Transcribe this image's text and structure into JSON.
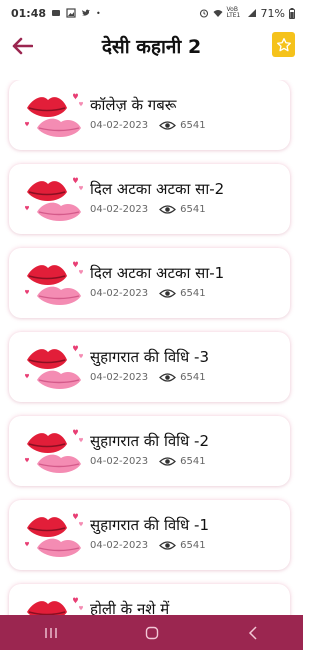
{
  "status_bar": {
    "time": "01:48",
    "network_label": "VoB LTE1",
    "battery": "71%",
    "left_icons": [
      "notification-message-icon",
      "gallery-icon",
      "twitter-icon",
      "telegram-icon"
    ],
    "right_icons": [
      "alarm-icon",
      "wifi-icon",
      "signal-icon",
      "battery-icon"
    ]
  },
  "app_bar": {
    "title": "देसी कहानी 2",
    "back_icon": "arrow-left-icon",
    "favorite_icon": "star-icon",
    "accent": "#9b2650",
    "favorite_color": "#f5c21b"
  },
  "stories": [
    {
      "title": "कॉलेज़ के गबरू",
      "date": "04-02-2023",
      "views": "6541",
      "thumb_icon": "lips-hearts-icon"
    },
    {
      "title": "दिल अटका अटका सा-2",
      "date": "04-02-2023",
      "views": "6541",
      "thumb_icon": "lips-hearts-icon"
    },
    {
      "title": "दिल अटका अटका सा-1",
      "date": "04-02-2023",
      "views": "6541",
      "thumb_icon": "lips-hearts-icon"
    },
    {
      "title": "सुहागरात की विधि -3",
      "date": "04-02-2023",
      "views": "6541",
      "thumb_icon": "lips-hearts-icon"
    },
    {
      "title": "सुहागरात की विधि -2",
      "date": "04-02-2023",
      "views": "6541",
      "thumb_icon": "lips-hearts-icon"
    },
    {
      "title": "सुहागरात की विधि -1",
      "date": "04-02-2023",
      "views": "6541",
      "thumb_icon": "lips-hearts-icon"
    },
    {
      "title": "होली के नशे में",
      "date": "",
      "views": "",
      "thumb_icon": "lips-hearts-icon"
    }
  ],
  "nav_bar": {
    "buttons": [
      "recent-apps-icon",
      "home-icon",
      "back-icon"
    ],
    "color": "#9b2650"
  }
}
